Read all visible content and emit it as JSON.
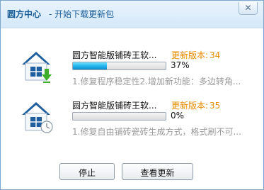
{
  "window": {
    "title": "圆方中心",
    "subtitle": "-  开始下载更新包",
    "close_glyph": "✕"
  },
  "updates": [
    {
      "name": "圆方智能版铺砖王软...",
      "version_label": "更新版本:",
      "version": "34",
      "progress_percent": 37,
      "progress_text": "37%",
      "description": "1.修复程序稳定性2.增加新功能：多边转角...",
      "icon": "house-download-icon",
      "status": "downloading"
    },
    {
      "name": "圆方智能版铺砖王软...",
      "version_label": "更新版本:",
      "version": "35",
      "progress_percent": 0,
      "progress_text": "0%",
      "description": "1.修复自由铺砖瓷砖生成方式，格式刷不可...",
      "icon": "house-clock-icon",
      "status": "waiting"
    }
  ],
  "buttons": {
    "stop": "停止",
    "view": "查看更新"
  },
  "colors": {
    "accent": "#1a5e98",
    "version": "#e58b00",
    "progress": "#1fb2ea",
    "description": "#9a9a9a"
  }
}
